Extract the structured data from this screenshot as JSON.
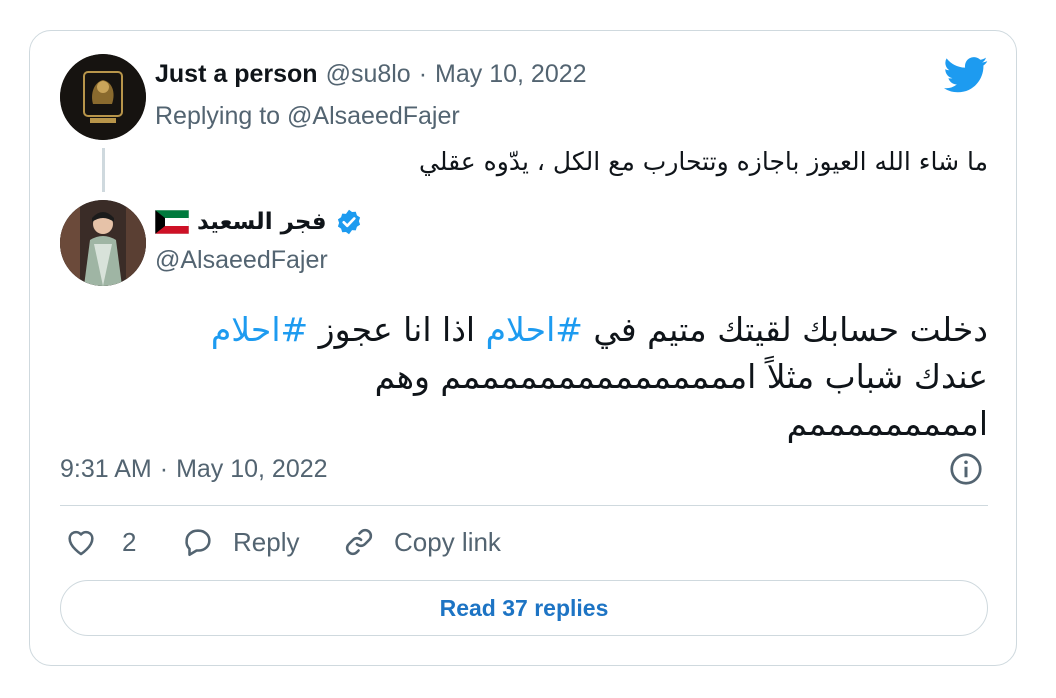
{
  "reply_tweet": {
    "author_name": "Just a person",
    "handle": "@su8lo",
    "separator": "·",
    "date": "May 10, 2022",
    "replying_to_prefix": "Replying to",
    "replying_to_handle": "@AlsaeedFajer",
    "text": "ما شاء الله العيوز باجازه وتتحارب مع الكل ، يدّوه عقلي"
  },
  "main_tweet": {
    "author_name": "فجر السعيد",
    "handle": "@AlsaeedFajer",
    "verified": true,
    "text_line1_a": "دخلت حسابك لقيتك متيم في",
    "hashtag1": "#احلام",
    "text_line1_b": "اذا انا عجوز",
    "hashtag2": "#احلام",
    "text_line2": "عندك شباب مثلاً امممممممممممممممم وهم",
    "text_line3": "امممممممممم",
    "time": "9:31 AM",
    "separator": "·",
    "date": "May 10, 2022"
  },
  "actions": {
    "like_count": "2",
    "reply_label": "Reply",
    "copy_link_label": "Copy link"
  },
  "read_replies_label": "Read 37 replies",
  "colors": {
    "twitter_blue": "#1d9bf0",
    "link_blue": "#1d74c4",
    "border": "#cfd9de",
    "muted_text": "#536471"
  },
  "icons": [
    "twitter-logo-icon",
    "kuwait-flag-icon",
    "verified-badge-icon",
    "info-icon",
    "heart-icon",
    "reply-bubble-icon",
    "link-icon"
  ]
}
